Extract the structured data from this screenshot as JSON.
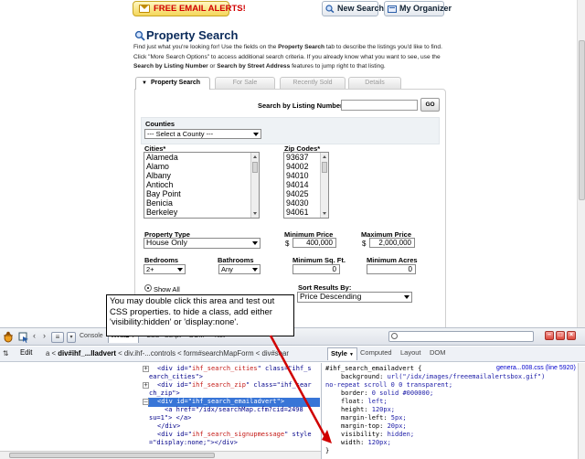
{
  "toolbar": {
    "alert_button": "FREE EMAIL ALERTS!",
    "new_search": "New Search",
    "organizer": "My Organizer"
  },
  "page": {
    "title": "Property Search",
    "intro_1": "Find just what you're looking for! Use the fields on the ",
    "intro_b1": "Property Search",
    "intro_2": " tab to describe the listings you'd like to find. Click \"More Search Options\" to access additional search criteria. If you already know what you want to see, use the ",
    "intro_b2": "Search by Listing Number",
    "intro_3": " or ",
    "intro_b3": "Search by Street Address",
    "intro_4": " features to jump right to that listing."
  },
  "tabs": [
    "Property Search",
    "For Sale",
    "Recently Sold",
    "Details"
  ],
  "form": {
    "listing_label": "Search by Listing Number:",
    "go": "GO",
    "counties_label": "Counties",
    "county_value": "--- Select a County ---",
    "cities_label": "Cities*",
    "cities": [
      "Alameda",
      "Alamo",
      "Albany",
      "Antioch",
      "Bay Point",
      "Benicia",
      "Berkeley"
    ],
    "zip_label": "Zip Codes*",
    "zips": [
      "93637",
      "94002",
      "94010",
      "94014",
      "94025",
      "94030",
      "94061"
    ],
    "ptype_label": "Property Type",
    "ptype_value": "House Only",
    "minprice_label": "Minimum Price",
    "minprice_value": "400,000",
    "maxprice_label": "Maximum Price",
    "maxprice_value": "2,000,000",
    "dollar": "$",
    "bed_label": "Bedrooms",
    "bed_value": "2+",
    "bath_label": "Bathrooms",
    "bath_value": "Any",
    "sqft_label": "Minimum Sq. Ft.",
    "sqft_value": "0",
    "acres_label": "Minimum Acres",
    "acres_value": "0",
    "show_all": "Show All",
    "sort_label": "Sort Results By:",
    "sort_value": "Price Descending"
  },
  "tooltip": "You may double click this area and test out CSS properties. to hide a class, add either 'visibility:hidden' or 'display:none'.",
  "firebug": {
    "tabs": [
      "Console",
      "HTML",
      "CSS",
      "Script",
      "DOM",
      "Net"
    ],
    "edit": "Edit",
    "breadcrumb": [
      "a",
      "div#ihf_...lladvert",
      "div.ihf-...controls",
      "form#searchMapForm",
      "div#sear"
    ],
    "side_tabs": [
      "Style",
      "Computed",
      "Layout",
      "DOM"
    ],
    "html_lines": [
      {
        "pre": "<div id=\"",
        "attr": "ihf_search_cities",
        "post": "\" class=\"ihf_s"
      },
      {
        "pre": "earch_cities\">",
        "attr": "",
        "post": ""
      },
      {
        "pre": "<div id=\"",
        "attr": "ihf_search_zip",
        "post": "\" class=\"ihf_sear"
      },
      {
        "pre": "ch_zip\">",
        "attr": "",
        "post": ""
      },
      {
        "pre": "<div id=\"ihf_search_emailadvert\">",
        "attr": "",
        "post": ""
      },
      {
        "pre": "<a href=\"/idx/searchMap.cfm?cid=2498",
        "attr": "",
        "post": ""
      },
      {
        "pre": "su=1\"> </a>",
        "attr": "",
        "post": ""
      },
      {
        "pre": "</div>",
        "attr": "",
        "post": ""
      },
      {
        "pre": "<div id=\"",
        "attr": "ihf_search_signupmessage",
        "post": "\" style"
      },
      {
        "pre": "=\"display:none;\"></div>",
        "attr": "",
        "post": ""
      }
    ],
    "css_selector": "#ihf_search_emailadvert {",
    "css_link": "genera...008.css (line 5920)",
    "css_lines": [
      "background: url(\"/idx/images/freeemailalertsbox.gif\")",
      "no-repeat scroll 0 0 transparent;",
      "border: 0 solid #000000;",
      "float: left;",
      "height: 120px;",
      "margin-left: 5px;",
      "margin-top: 20px;",
      "visibility: hidden;",
      "width: 120px;",
      "}"
    ]
  },
  "colors": {
    "accent_red": "#cc0000",
    "selection_blue": "#3875d7",
    "title_navy": "#0a2a5a"
  }
}
